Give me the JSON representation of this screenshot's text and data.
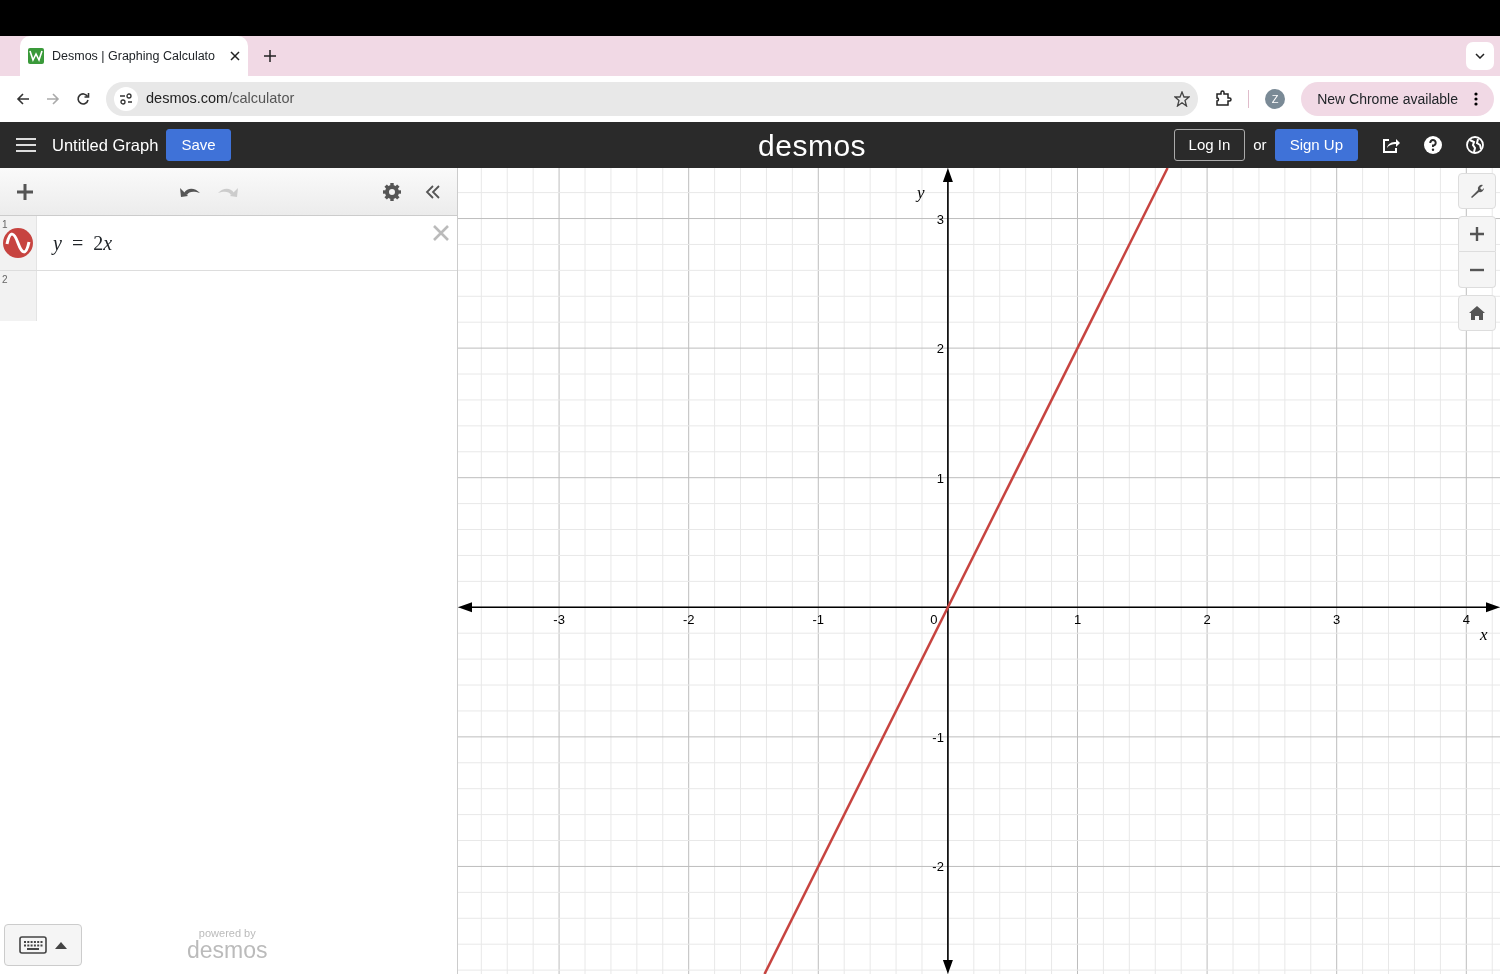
{
  "browser": {
    "tabs": [
      {
        "title": "Desmos | Graphing Calculato",
        "selected": true
      }
    ],
    "nav": [
      {
        "kind": "back",
        "disabled": false
      },
      {
        "kind": "forward",
        "disabled": true
      },
      {
        "kind": "reload",
        "disabled": false
      }
    ],
    "url": {
      "host": "desmos.com",
      "path": "/calculator"
    },
    "profile": "Z",
    "update": "New Chrome available"
  },
  "header": {
    "title": "Untitled Graph",
    "save": "Save",
    "logo": "desmos",
    "login": "Log In",
    "or": "or",
    "signup": "Sign Up"
  },
  "toolbar": {
    "undo": {
      "disabled": false
    },
    "redo": {
      "disabled": true
    }
  },
  "expressions": [
    {
      "number": "1",
      "tokens": [
        {
          "kind": "var",
          "text": "y"
        },
        {
          "kind": "op",
          "text": "="
        },
        {
          "kind": "num",
          "text": "2"
        },
        {
          "kind": "var",
          "text": "x"
        }
      ],
      "color": "#c74440"
    },
    {
      "number": "2"
    }
  ],
  "footer": {
    "powered": "powered by",
    "logo": "desmos"
  },
  "graph": {
    "chart_data": {
      "type": "line",
      "grid": true,
      "xlabel": "x",
      "ylabel": "y",
      "xlim": [
        -3.78,
        4.26
      ],
      "ylim": [
        -2.83,
        3.39
      ],
      "xticks": [
        -3,
        -2,
        -1,
        1,
        2,
        3,
        4
      ],
      "yticks": [
        -2,
        -1,
        1,
        2,
        3
      ],
      "x": [
        -1.415,
        1.695
      ],
      "series": [
        {
          "color": "#c74440",
          "values": [
            -2.83,
            3.39
          ]
        }
      ]
    },
    "origin_label": "0"
  }
}
